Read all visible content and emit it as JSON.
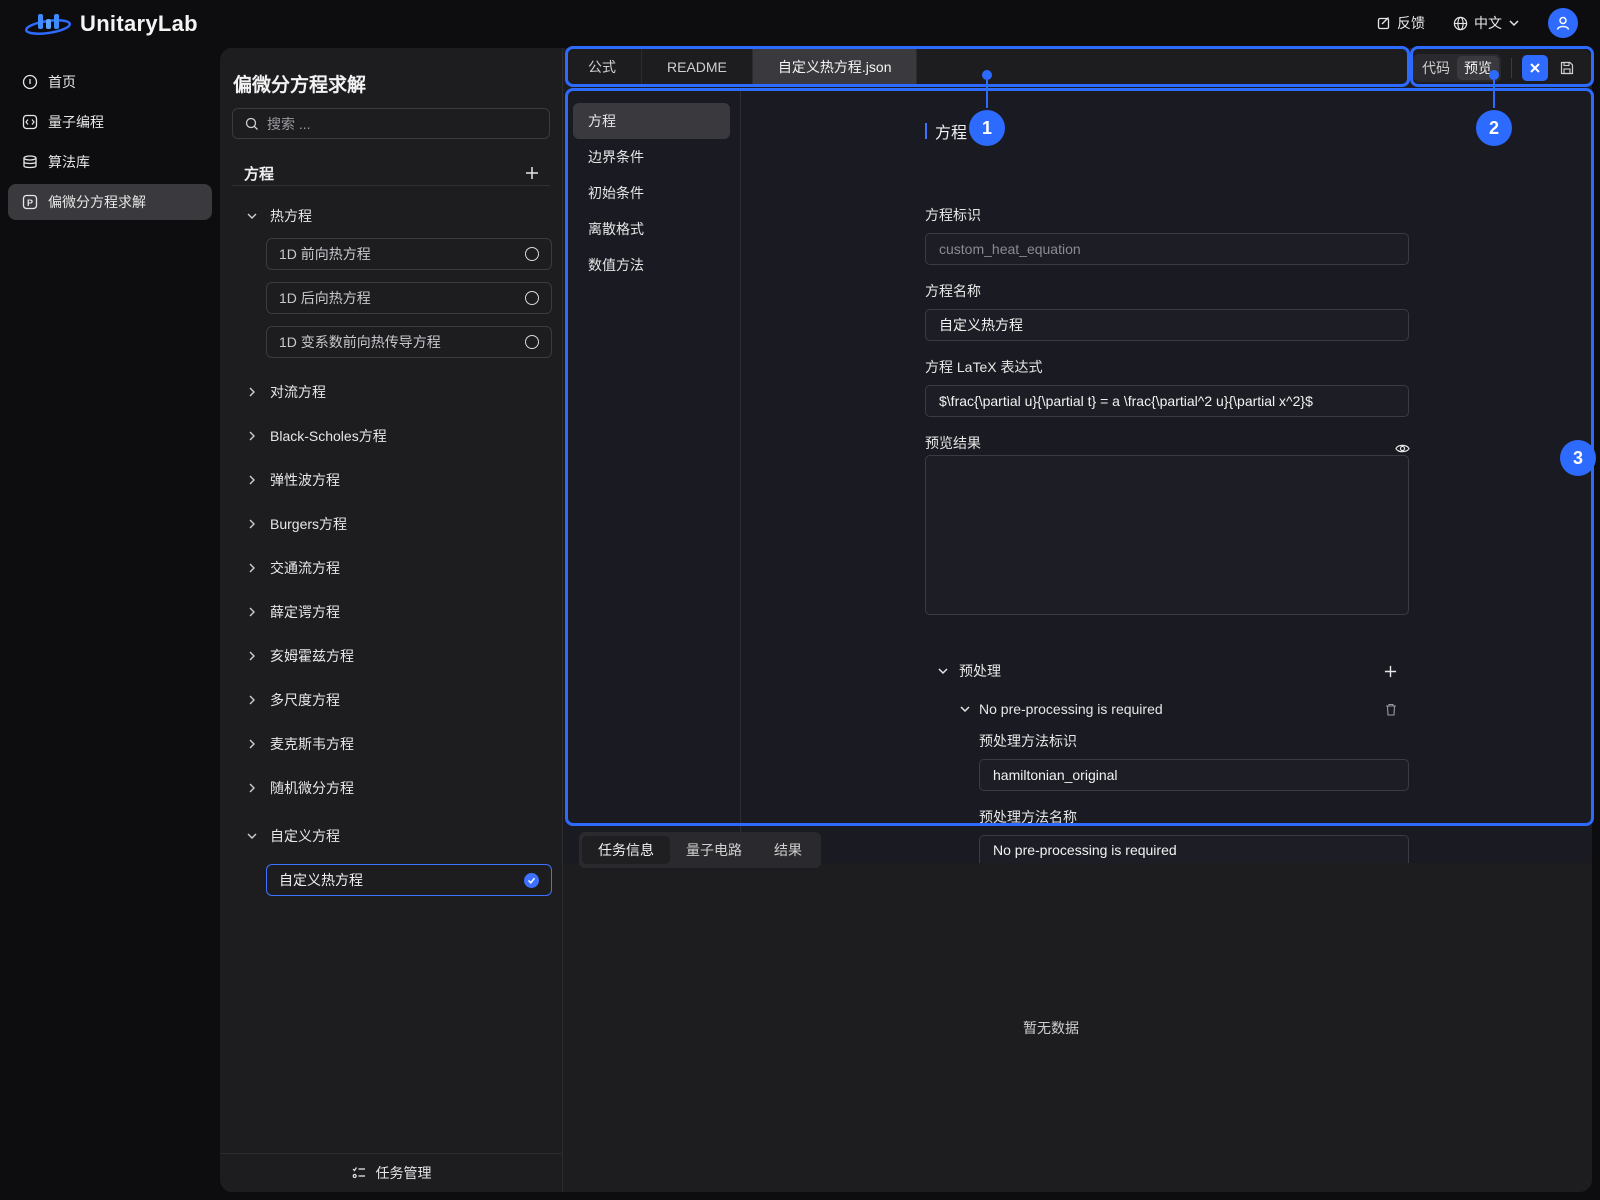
{
  "app": {
    "name": "UnitaryLab"
  },
  "header": {
    "feedback": "反馈",
    "language": "中文"
  },
  "leftnav": {
    "items": [
      {
        "label": "首页",
        "icon": "home-icon"
      },
      {
        "label": "量子编程",
        "icon": "code-icon"
      },
      {
        "label": "算法库",
        "icon": "library-icon"
      },
      {
        "label": "偏微分方程求解",
        "icon": "pde-icon",
        "active": true
      }
    ]
  },
  "eqpanel": {
    "title": "偏微分方程求解",
    "search_placeholder": "搜索 ...",
    "section": "方程",
    "groups": [
      {
        "label": "热方程",
        "expanded": true,
        "leaves": [
          "1D 前向热方程",
          "1D 后向热方程",
          "1D 变系数前向热传导方程"
        ]
      },
      {
        "label": "对流方程"
      },
      {
        "label": "Black-Scholes方程"
      },
      {
        "label": "弹性波方程"
      },
      {
        "label": "Burgers方程"
      },
      {
        "label": "交通流方程"
      },
      {
        "label": "薛定谔方程"
      },
      {
        "label": "亥姆霍兹方程"
      },
      {
        "label": "多尺度方程"
      },
      {
        "label": "麦克斯韦方程"
      },
      {
        "label": "随机微分方程"
      },
      {
        "label": "自定义方程",
        "expanded": true,
        "leaves": [
          "自定义热方程"
        ],
        "selected": "自定义热方程"
      }
    ],
    "task_manager": "任务管理"
  },
  "tabs": [
    "公式",
    "README",
    "自定义热方程.json"
  ],
  "active_tab": "自定义热方程.json",
  "view_mode": {
    "code": "代码",
    "preview": "预览",
    "active": "预览"
  },
  "sections": [
    "方程",
    "边界条件",
    "初始条件",
    "离散格式",
    "数值方法"
  ],
  "form": {
    "heading": "方程",
    "id_label": "方程标识",
    "id_placeholder": "custom_heat_equation",
    "name_label": "方程名称",
    "name_value": "自定义热方程",
    "latex_label": "方程 LaTeX 表达式",
    "latex_value": "$\\frac{\\partial u}{\\partial t} = a \\frac{\\partial^2 u}{\\partial x^2}$",
    "preview_label": "预览结果",
    "preprocess": {
      "label": "预处理",
      "item_title": "No pre-processing is required",
      "method_id_label": "预处理方法标识",
      "method_id_value": "hamiltonian_original",
      "method_name_label": "预处理方法名称",
      "method_name_value": "No pre-processing is required"
    }
  },
  "bottom_tabs": [
    "任务信息",
    "量子电路",
    "结果"
  ],
  "no_data": "暂无数据",
  "annotations": [
    "1",
    "2",
    "3"
  ],
  "colors": {
    "accent": "#2f6bff",
    "annotation": "#2d6bff",
    "panel": "#1d1d20",
    "page": "#0d0d0f"
  }
}
